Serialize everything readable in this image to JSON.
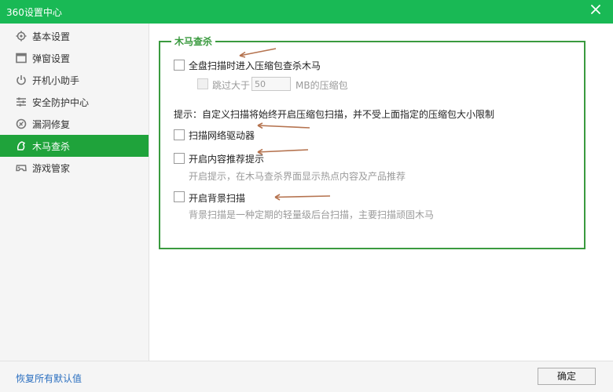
{
  "window": {
    "title": "360设置中心"
  },
  "sidebar": {
    "items": [
      {
        "label": "基本设置",
        "icon": "gear-icon"
      },
      {
        "label": "弹窗设置",
        "icon": "window-icon"
      },
      {
        "label": "开机小助手",
        "icon": "power-icon"
      },
      {
        "label": "安全防护中心",
        "icon": "sliders-icon"
      },
      {
        "label": "漏洞修复",
        "icon": "patch-icon"
      },
      {
        "label": "木马查杀",
        "icon": "trojan-icon",
        "active": true
      },
      {
        "label": "游戏管家",
        "icon": "gamepad-icon"
      }
    ]
  },
  "main": {
    "group_title": "木马查杀",
    "options": {
      "full_scan": {
        "label": "全盘扫描时进入压缩包查杀木马",
        "checked": false
      },
      "skip_larger": {
        "label_prefix": "跳过大于",
        "value": "50",
        "label_suffix": "MB的压缩包",
        "checked": false,
        "disabled": true
      },
      "hint": "提示：自定义扫描将始终开启压缩包扫描，并不受上面指定的压缩包大小限制",
      "scan_network_driver": {
        "label": "扫描网络驱动器",
        "checked": false
      },
      "content_recommend": {
        "label": "开启内容推荐提示",
        "checked": false,
        "description": "开启提示，在木马查杀界面显示热点内容及产品推荐"
      },
      "background_scan": {
        "label": "开启背景扫描",
        "checked": false,
        "description": "背景扫描是一种定期的轻量级后台扫描，主要扫描顽固木马"
      }
    }
  },
  "footer": {
    "reset_label": "恢复所有默认值",
    "ok_label": "确定"
  },
  "colors": {
    "titlebar": "#19b955",
    "active_nav": "#1fa33b",
    "group_border": "#3a9a3f",
    "link": "#2b6fc0",
    "annotation_arrow": "#b5734f"
  }
}
